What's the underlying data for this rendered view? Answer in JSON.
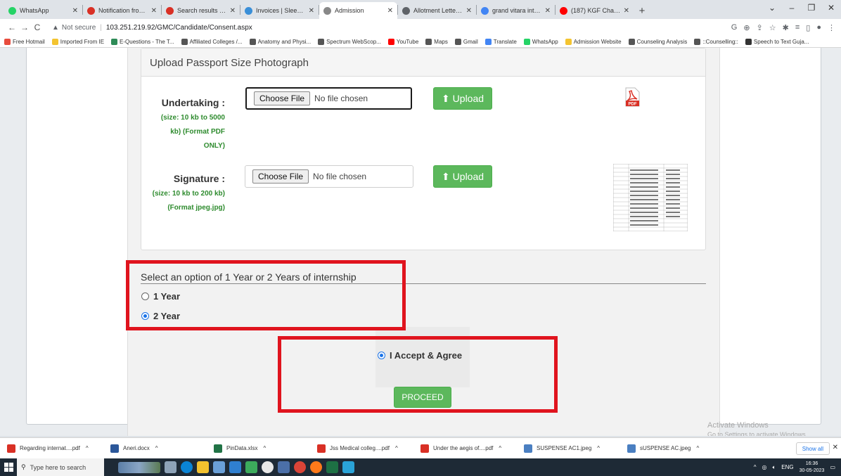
{
  "tabs": [
    {
      "label": "WhatsApp",
      "icon": "whatsapp-icon",
      "color": "#25d366",
      "active": false
    },
    {
      "label": "Notification from Axis Ban",
      "icon": "gmail-icon",
      "color": "#d93025",
      "active": false
    },
    {
      "label": "Search results - devarshie",
      "icon": "gmail-icon",
      "color": "#d93025",
      "active": false
    },
    {
      "label": "Invoices | Sleek Bill",
      "icon": "sleekbill-icon",
      "color": "#3a8fd8",
      "active": false
    },
    {
      "label": "Admission",
      "icon": "globe-icon",
      "color": "#888888",
      "active": true
    },
    {
      "label": "Allotment Letter - 23-24",
      "icon": "globe-icon",
      "color": "#5f6368",
      "active": false
    },
    {
      "label": "grand vitara internal struc",
      "icon": "google-icon",
      "color": "#4285f4",
      "active": false
    },
    {
      "label": "(187) KGF Chapter 2 Movi",
      "icon": "youtube-icon",
      "color": "#ff0000",
      "active": false
    }
  ],
  "address": {
    "security_text": "Not secure",
    "url": "103.251.219.92/GMC/Candidate/Consent.aspx"
  },
  "bookmarks": [
    {
      "label": "Free Hotmail",
      "color": "#e84c3d"
    },
    {
      "label": "Imported From IE",
      "color": "#f4c430"
    },
    {
      "label": "E-Questions - The T...",
      "color": "#2e8b57"
    },
    {
      "label": "Affiliated Colleges /...",
      "color": "#555555"
    },
    {
      "label": "Anatomy and Physi...",
      "color": "#555555"
    },
    {
      "label": "Spectrum WebScop...",
      "color": "#555555"
    },
    {
      "label": "YouTube",
      "color": "#ff0000"
    },
    {
      "label": "Maps",
      "color": "#555555"
    },
    {
      "label": "Gmail",
      "color": "#555555"
    },
    {
      "label": "Translate",
      "color": "#4285f4"
    },
    {
      "label": "WhatsApp",
      "color": "#25d366"
    },
    {
      "label": "Admission Website",
      "color": "#f4c430"
    },
    {
      "label": "Counseling Analysis",
      "color": "#555555"
    },
    {
      "label": "::Counselling::",
      "color": "#555555"
    },
    {
      "label": "Speech to Text Guja...",
      "color": "#333333"
    }
  ],
  "upload": {
    "heading": "Upload Passport Size Photograph",
    "undertaking": {
      "label": "Undertaking :",
      "hint_lines": [
        "(size: 10 kb to 5000",
        "kb) (Format PDF",
        "ONLY)"
      ],
      "choose_label": "Choose File",
      "file_status": "No file chosen",
      "upload_label": "Upload"
    },
    "signature": {
      "label": "Signature :",
      "hint_lines": [
        "(size: 10 kb to 200 kb)",
        "(Format jpeg.jpg)"
      ],
      "choose_label": "Choose File",
      "file_status": "No file chosen",
      "upload_label": "Upload"
    },
    "pdf_icon_text": "PDF"
  },
  "internship": {
    "title": "Select an option of 1 Year or 2 Years of internship",
    "options": [
      {
        "label": "1 Year",
        "checked": false
      },
      {
        "label": "2 Year",
        "checked": true
      }
    ]
  },
  "agreement": {
    "label": "I Accept & Agree",
    "checked": true,
    "proceed_label": "PROCEED"
  },
  "watermark": {
    "line1": "Activate Windows",
    "line2": "Go to Settings to activate Windows."
  },
  "downloads": [
    {
      "name": "Regarding internat....pdf",
      "color": "#d93025"
    },
    {
      "name": "Aneri.docx",
      "color": "#2b579a"
    },
    {
      "name": "PinData.xlsx",
      "color": "#217346"
    },
    {
      "name": "Jss Medical colleg....pdf",
      "color": "#d93025"
    },
    {
      "name": "Under the aegis of....pdf",
      "color": "#d93025"
    },
    {
      "name": "SUSPENSE AC1.jpeg",
      "color": "#4a7fc1"
    },
    {
      "name": "sUSPENSE AC.jpeg",
      "color": "#4a7fc1"
    }
  ],
  "show_all": "Show all",
  "taskbar": {
    "search_placeholder": "Type here to search",
    "language": "ENG",
    "time": "16:36",
    "date": "30-05-2023"
  },
  "colors": {
    "accent_red": "#e0141e",
    "upload_green": "#5cb85c",
    "hint_green": "#2e8b2e",
    "radio_blue": "#1a73e8"
  }
}
